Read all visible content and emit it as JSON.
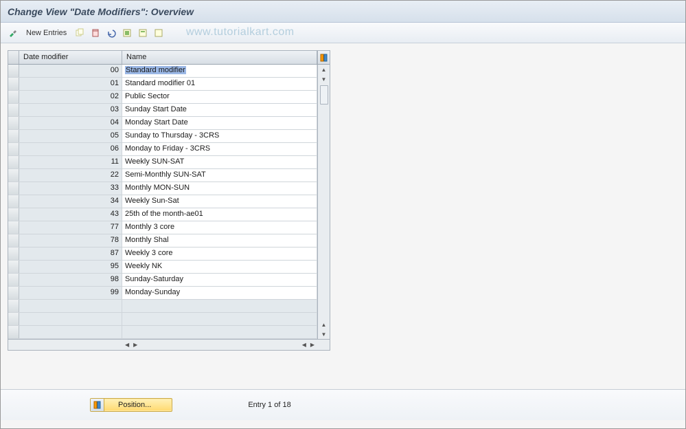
{
  "title": "Change View \"Date Modifiers\": Overview",
  "toolbar": {
    "new_entries": "New Entries"
  },
  "watermark": "www.tutorialkart.com",
  "grid": {
    "headers": {
      "modifier": "Date modifier",
      "name": "Name"
    },
    "rows": [
      {
        "mod": "00",
        "name": "Standard modifier",
        "selected": true
      },
      {
        "mod": "01",
        "name": "Standard modifier 01"
      },
      {
        "mod": "02",
        "name": "Public Sector"
      },
      {
        "mod": "03",
        "name": "Sunday Start Date"
      },
      {
        "mod": "04",
        "name": "Monday Start Date"
      },
      {
        "mod": "05",
        "name": "Sunday to Thursday - 3CRS"
      },
      {
        "mod": "06",
        "name": "Monday to Friday - 3CRS"
      },
      {
        "mod": "11",
        "name": "Weekly SUN-SAT"
      },
      {
        "mod": "22",
        "name": "Semi-Monthly SUN-SAT"
      },
      {
        "mod": "33",
        "name": "Monthly MON-SUN"
      },
      {
        "mod": "34",
        "name": "Weekly Sun-Sat"
      },
      {
        "mod": "43",
        "name": "25th of the month-ae01"
      },
      {
        "mod": "77",
        "name": "Monthly 3 core"
      },
      {
        "mod": "78",
        "name": "Monthly Shal"
      },
      {
        "mod": "87",
        "name": "Weekly 3 core"
      },
      {
        "mod": "95",
        "name": "Weekly NK"
      },
      {
        "mod": "98",
        "name": "Sunday-Saturday"
      },
      {
        "mod": "99",
        "name": "Monday-Sunday"
      }
    ],
    "empty_rows": 3
  },
  "footer": {
    "position_label": "Position...",
    "entry_text": "Entry 1 of 18"
  }
}
